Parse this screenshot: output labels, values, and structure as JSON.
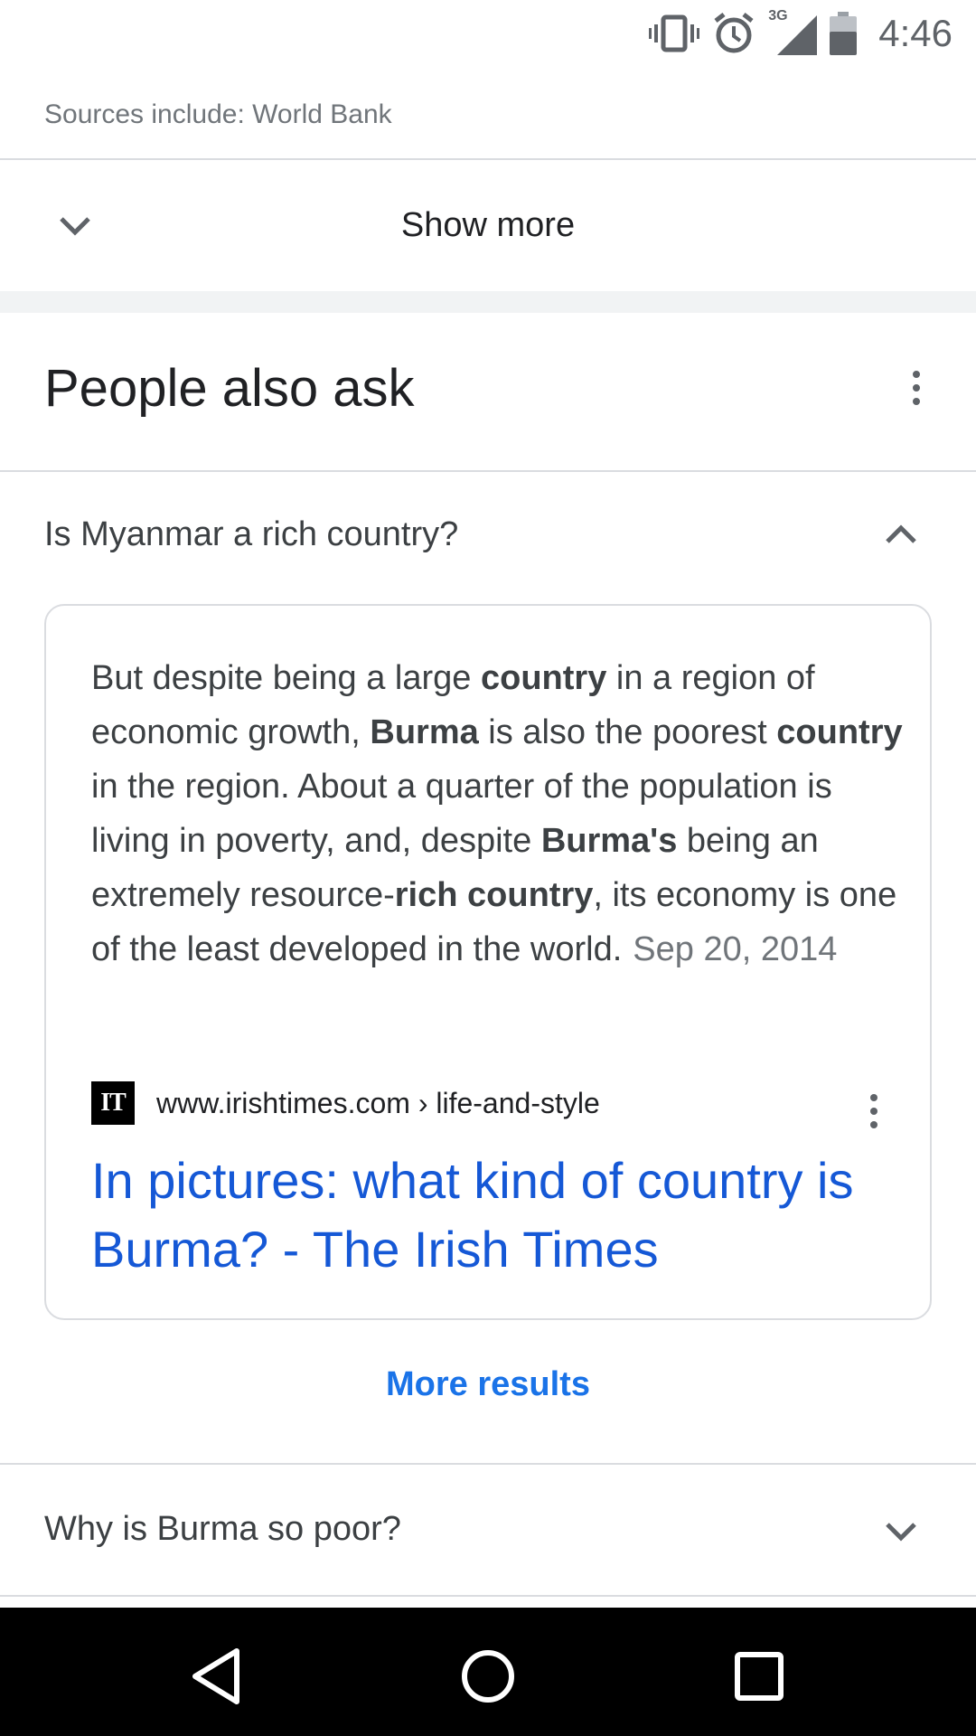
{
  "status_bar": {
    "time": "4:46",
    "network": "3G",
    "icons": [
      "vibrate-icon",
      "alarm-icon",
      "signal-icon",
      "battery-icon"
    ]
  },
  "sources": {
    "text": "Sources include: World Bank"
  },
  "show_more": {
    "label": "Show more"
  },
  "people_also_ask": {
    "title": "People also ask",
    "questions": [
      {
        "question": "Is Myanmar a rich country?",
        "expanded": true,
        "answer": {
          "segments": [
            {
              "text": "But despite being a large ",
              "bold": false
            },
            {
              "text": "country",
              "bold": true
            },
            {
              "text": " in a region of economic growth, ",
              "bold": false
            },
            {
              "text": "Burma",
              "bold": true
            },
            {
              "text": " is also the poorest ",
              "bold": false
            },
            {
              "text": "country",
              "bold": true
            },
            {
              "text": " in the region. About a quarter of the population is living in poverty, and, despite ",
              "bold": false
            },
            {
              "text": "Burma's",
              "bold": true
            },
            {
              "text": " being an extremely resource-",
              "bold": false
            },
            {
              "text": "rich country",
              "bold": true
            },
            {
              "text": ", its economy is one of the least developed in the world.",
              "bold": false
            }
          ],
          "date": "Sep 20, 2014",
          "favicon_text": "IT",
          "source_url": "www.irishtimes.com › life-and-style",
          "link_title": "In pictures: what kind of country is Burma? - The Irish Times"
        }
      },
      {
        "question": "Why is Burma so poor?",
        "expanded": false
      }
    ],
    "more_results_label": "More results"
  },
  "colors": {
    "link": "#1558d6",
    "accent": "#1a73e8",
    "divider": "#dadce0",
    "nav_bar": "#000000"
  }
}
